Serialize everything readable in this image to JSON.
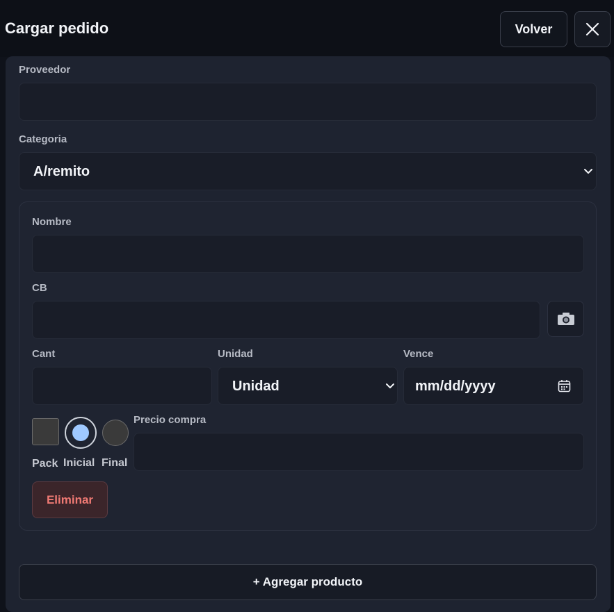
{
  "header": {
    "title": "Cargar pedido",
    "back_label": "Volver"
  },
  "form": {
    "proveedor": {
      "label": "Proveedor",
      "value": ""
    },
    "categoria": {
      "label": "Categoria",
      "value": "A/remito"
    }
  },
  "product": {
    "nombre": {
      "label": "Nombre",
      "value": ""
    },
    "cb": {
      "label": "CB",
      "value": ""
    },
    "cant": {
      "label": "Cant",
      "value": ""
    },
    "unidad": {
      "label": "Unidad",
      "value": "Unidad"
    },
    "vence": {
      "label": "Vence",
      "placeholder": "mm/dd/yyyy"
    },
    "options": {
      "pack": "Pack",
      "inicial": "Inicial",
      "final": "Final",
      "selected": "Inicial"
    },
    "precio": {
      "label": "Precio compra",
      "value": ""
    },
    "delete_label": "Eliminar"
  },
  "actions": {
    "add_label": "+ Agregar producto"
  },
  "colors": {
    "background": "#0f121a",
    "panel": "#1e2330",
    "danger": "#f07a74",
    "radio_selected": "#9fc9ff"
  },
  "icons": {
    "close": "close-icon",
    "camera": "camera-icon",
    "calendar": "calendar-icon",
    "chevron": "chevron-down-icon"
  }
}
